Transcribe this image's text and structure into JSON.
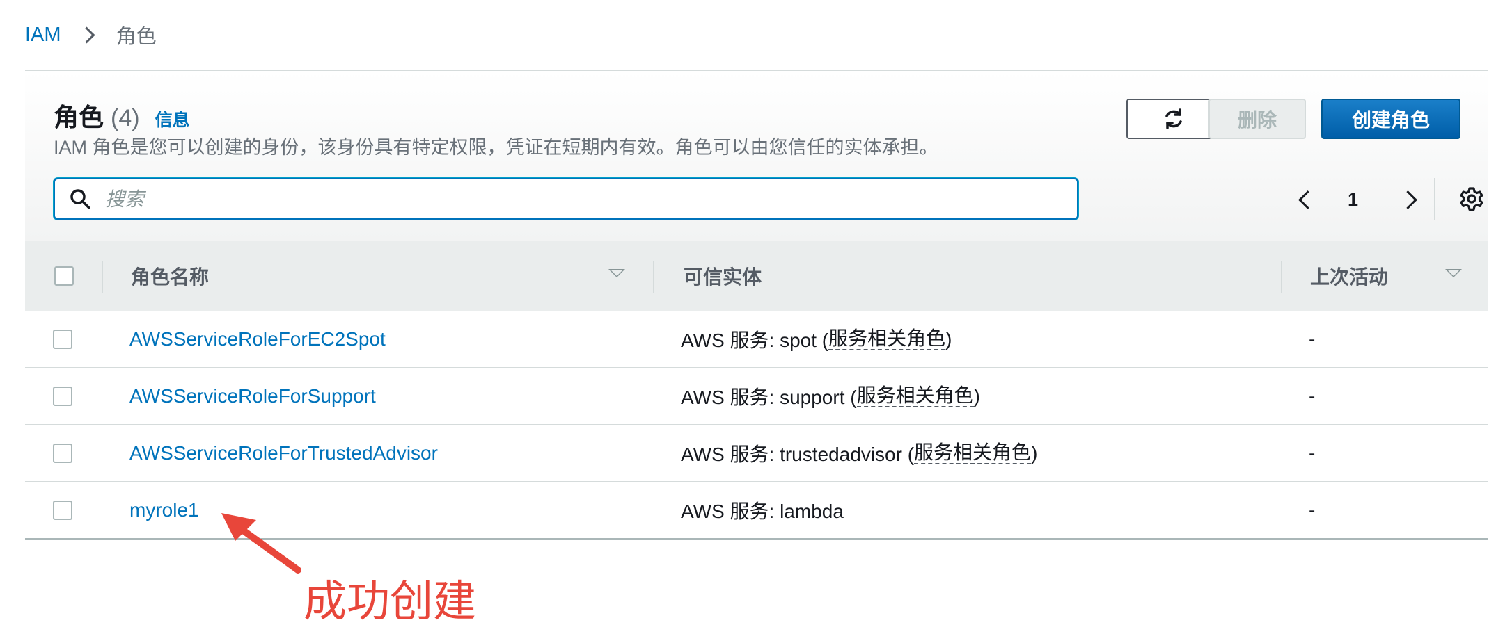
{
  "breadcrumb": {
    "root": "IAM",
    "current": "角色"
  },
  "header": {
    "title": "角色",
    "count": "(4)",
    "info_link": "信息",
    "description": "IAM 角色是您可以创建的身份，该身份具有特定权限，凭证在短期内有效。角色可以由您信任的实体承担。"
  },
  "actions": {
    "refresh_icon": "refresh-icon",
    "delete_label": "删除",
    "create_label": "创建角色"
  },
  "search": {
    "placeholder": "搜索",
    "value": ""
  },
  "pagination": {
    "current_page": "1"
  },
  "table": {
    "columns": [
      "角色名称",
      "可信实体",
      "上次活动"
    ],
    "rows": [
      {
        "name": "AWSServiceRoleForEC2Spot",
        "entity_prefix": "AWS 服务: spot (",
        "entity_tag": "服务相关角色",
        "entity_suffix": ")",
        "last_activity": "-"
      },
      {
        "name": "AWSServiceRoleForSupport",
        "entity_prefix": "AWS 服务: support (",
        "entity_tag": "服务相关角色",
        "entity_suffix": ")",
        "last_activity": "-"
      },
      {
        "name": "AWSServiceRoleForTrustedAdvisor",
        "entity_prefix": "AWS 服务: trustedadvisor (",
        "entity_tag": "服务相关角色",
        "entity_suffix": ")",
        "last_activity": "-"
      },
      {
        "name": "myrole1",
        "entity_prefix": "AWS 服务: lambda",
        "entity_tag": "",
        "entity_suffix": "",
        "last_activity": "-"
      }
    ]
  },
  "annotation": {
    "text": "成功创建",
    "color": "#e8463a"
  },
  "colors": {
    "link": "#0073bb",
    "primary_button": "#0073bb",
    "header_bg": "#eaeded"
  }
}
